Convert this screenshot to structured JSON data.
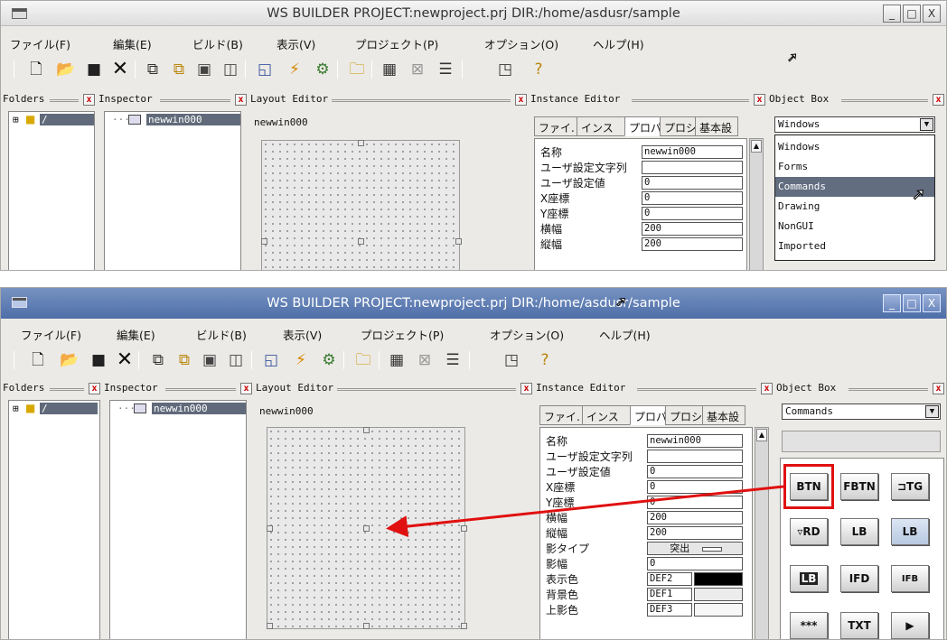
{
  "window": {
    "title": "WS BUILDER PROJECT:newproject.prj DIR:/home/asdusr/sample",
    "controls": [
      "_",
      "□",
      "X"
    ]
  },
  "menu": [
    "ファイル(F)",
    "編集(E)",
    "ビルド(B)",
    "表示(V)",
    "プロジェクト(P)",
    "オプション(O)",
    "ヘルプ(H)"
  ],
  "toolbar_icons": [
    "new-file-icon",
    "open-folder-icon",
    "save-icon",
    "delete-icon",
    "window-icon-1",
    "window-icon-2",
    "window-icon-3",
    "window-icon-4",
    "window-icon-5",
    "lightning-icon",
    "build-icon",
    "folder-window-icon",
    "calendar-icon",
    "tool-icon",
    "list-icon",
    "preview-icon",
    "help-icon"
  ],
  "panels": {
    "folders": "Folders",
    "inspector": "Inspector",
    "layout_editor": "Layout Editor",
    "instance_editor": "Instance Editor",
    "object_box": "Object Box"
  },
  "tree": {
    "root": "/",
    "window_node": "newwin000"
  },
  "layout": {
    "window_name": "newwin000"
  },
  "instance_tabs": [
    "ファイ.",
    "インス",
    "プロパ",
    "プロシ",
    "基本設"
  ],
  "properties": [
    {
      "label": "名称",
      "value": "newwin000"
    },
    {
      "label": "ユーザ設定文字列",
      "value": ""
    },
    {
      "label": "ユーザ設定値",
      "value": "0"
    },
    {
      "label": "X座標",
      "value": "0"
    },
    {
      "label": "Y座標",
      "value": "0"
    },
    {
      "label": "横幅",
      "value": "200"
    },
    {
      "label": "縦幅",
      "value": "200"
    },
    {
      "label": "影タイプ",
      "value": "突出"
    },
    {
      "label": "影幅",
      "value": "0"
    },
    {
      "label": "表示色",
      "value": "DEF2"
    },
    {
      "label": "背景色",
      "value": "DEF1"
    },
    {
      "label": "上影色",
      "value": "DEF3"
    }
  ],
  "object_box": {
    "combo_before": "Windows",
    "dropdown_items": [
      "Windows",
      "Forms",
      "Commands",
      "Drawing",
      "NonGUI",
      "Imported"
    ],
    "dropdown_highlight": "Commands",
    "combo_after": "Commands",
    "buttons": [
      "BTN",
      "FBTN",
      "⊐TG",
      "▿RD",
      "LB",
      "LB",
      "LB",
      "IFD",
      "IFB",
      "***",
      "TXT",
      "▶"
    ]
  },
  "colors": {
    "selection": "#606a7a",
    "active_title": "#4e6ea8",
    "annotation_red": "#e01010"
  }
}
